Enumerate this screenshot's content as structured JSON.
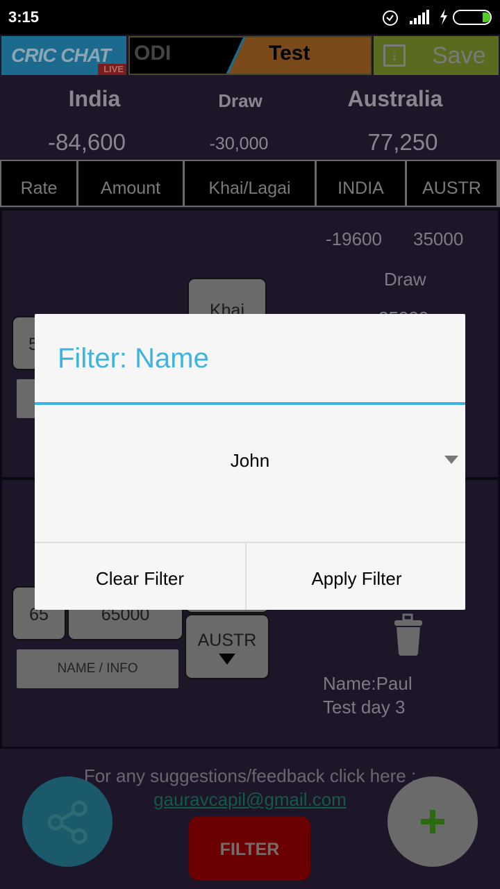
{
  "status_bar": {
    "time": "3:15",
    "icons": [
      "alarm-icon",
      "signal-icon",
      "charging-icon",
      "battery-icon"
    ]
  },
  "top_bar": {
    "logo": "CRIC CHAT",
    "logo_badge": "LIVE",
    "mode_odi": "ODI",
    "mode_test": "Test",
    "save_label": "Save"
  },
  "summary": [
    {
      "team": "India",
      "value": "-84,600"
    },
    {
      "team": "Draw",
      "value": "-30,000"
    },
    {
      "team": "Australia",
      "value": "77,250"
    }
  ],
  "columns": [
    "Rate",
    "Amount",
    "Khai/Lagai",
    "INDIA",
    "AUSTR"
  ],
  "card1": {
    "india": "-19600",
    "austr": "35000",
    "draw_label": "Draw",
    "draw_value": "35000",
    "rate": "5",
    "khai": "Khai"
  },
  "card2": {
    "rate": "65",
    "amount": "65000",
    "team_button": "AUSTR",
    "name_info": "NAME / INFO",
    "name": "Name:Paul",
    "info": "Test day 3"
  },
  "footer": {
    "feedback": "For any suggestions/feedback click here :",
    "email": "gauravcapil@gmail.com",
    "filter_button": "FILTER"
  },
  "dialog": {
    "title": "Filter: Name",
    "selected": "John",
    "clear": "Clear Filter",
    "apply": "Apply Filter"
  },
  "colors": {
    "accent": "#3db4e0",
    "filter_button": "#6b0000",
    "share_fab": "#1a5a6a",
    "add_fab": "#6a6a6a"
  }
}
